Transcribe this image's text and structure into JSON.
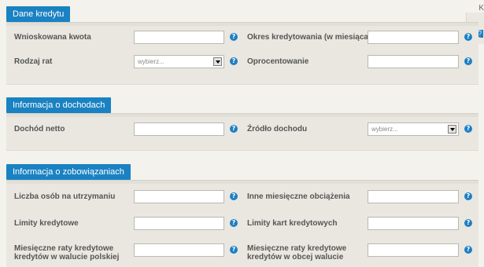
{
  "help_glyph": "?",
  "select_placeholder": "wybierz...",
  "accent_color": "#1a82c2",
  "edge": {
    "letter": "K"
  },
  "sections": [
    {
      "title": "Dane kredytu",
      "fields": [
        {
          "label": "Wnioskowana kwota",
          "type": "text",
          "value": ""
        },
        {
          "label": "Okres kredytowania (w miesiącach)",
          "type": "text",
          "value": ""
        },
        {
          "label": "Rodzaj rat",
          "type": "select",
          "value": "wybierz..."
        },
        {
          "label": "Oprocentowanie",
          "type": "text",
          "value": ""
        }
      ]
    },
    {
      "title": "Informacja o dochodach",
      "fields": [
        {
          "label": "Dochód netto",
          "type": "text",
          "value": ""
        },
        {
          "label": "Źródło dochodu",
          "type": "select",
          "value": "wybierz..."
        }
      ]
    },
    {
      "title": "Informacja o zobowiązaniach",
      "fields": [
        {
          "label": "Liczba osób na utrzymaniu",
          "type": "text",
          "value": ""
        },
        {
          "label": "Inne miesięczne obciążenia",
          "type": "text",
          "value": ""
        },
        {
          "label": "Limity kredytowe",
          "type": "text",
          "value": ""
        },
        {
          "label": "Limity kart kredytowych",
          "type": "text",
          "value": ""
        },
        {
          "label": "Miesięczne raty kredytowe kredytów w walucie polskiej",
          "type": "text",
          "value": ""
        },
        {
          "label": "Miesięczne raty kredytowe kredytów w obcej walucie",
          "type": "text",
          "value": ""
        }
      ]
    }
  ]
}
